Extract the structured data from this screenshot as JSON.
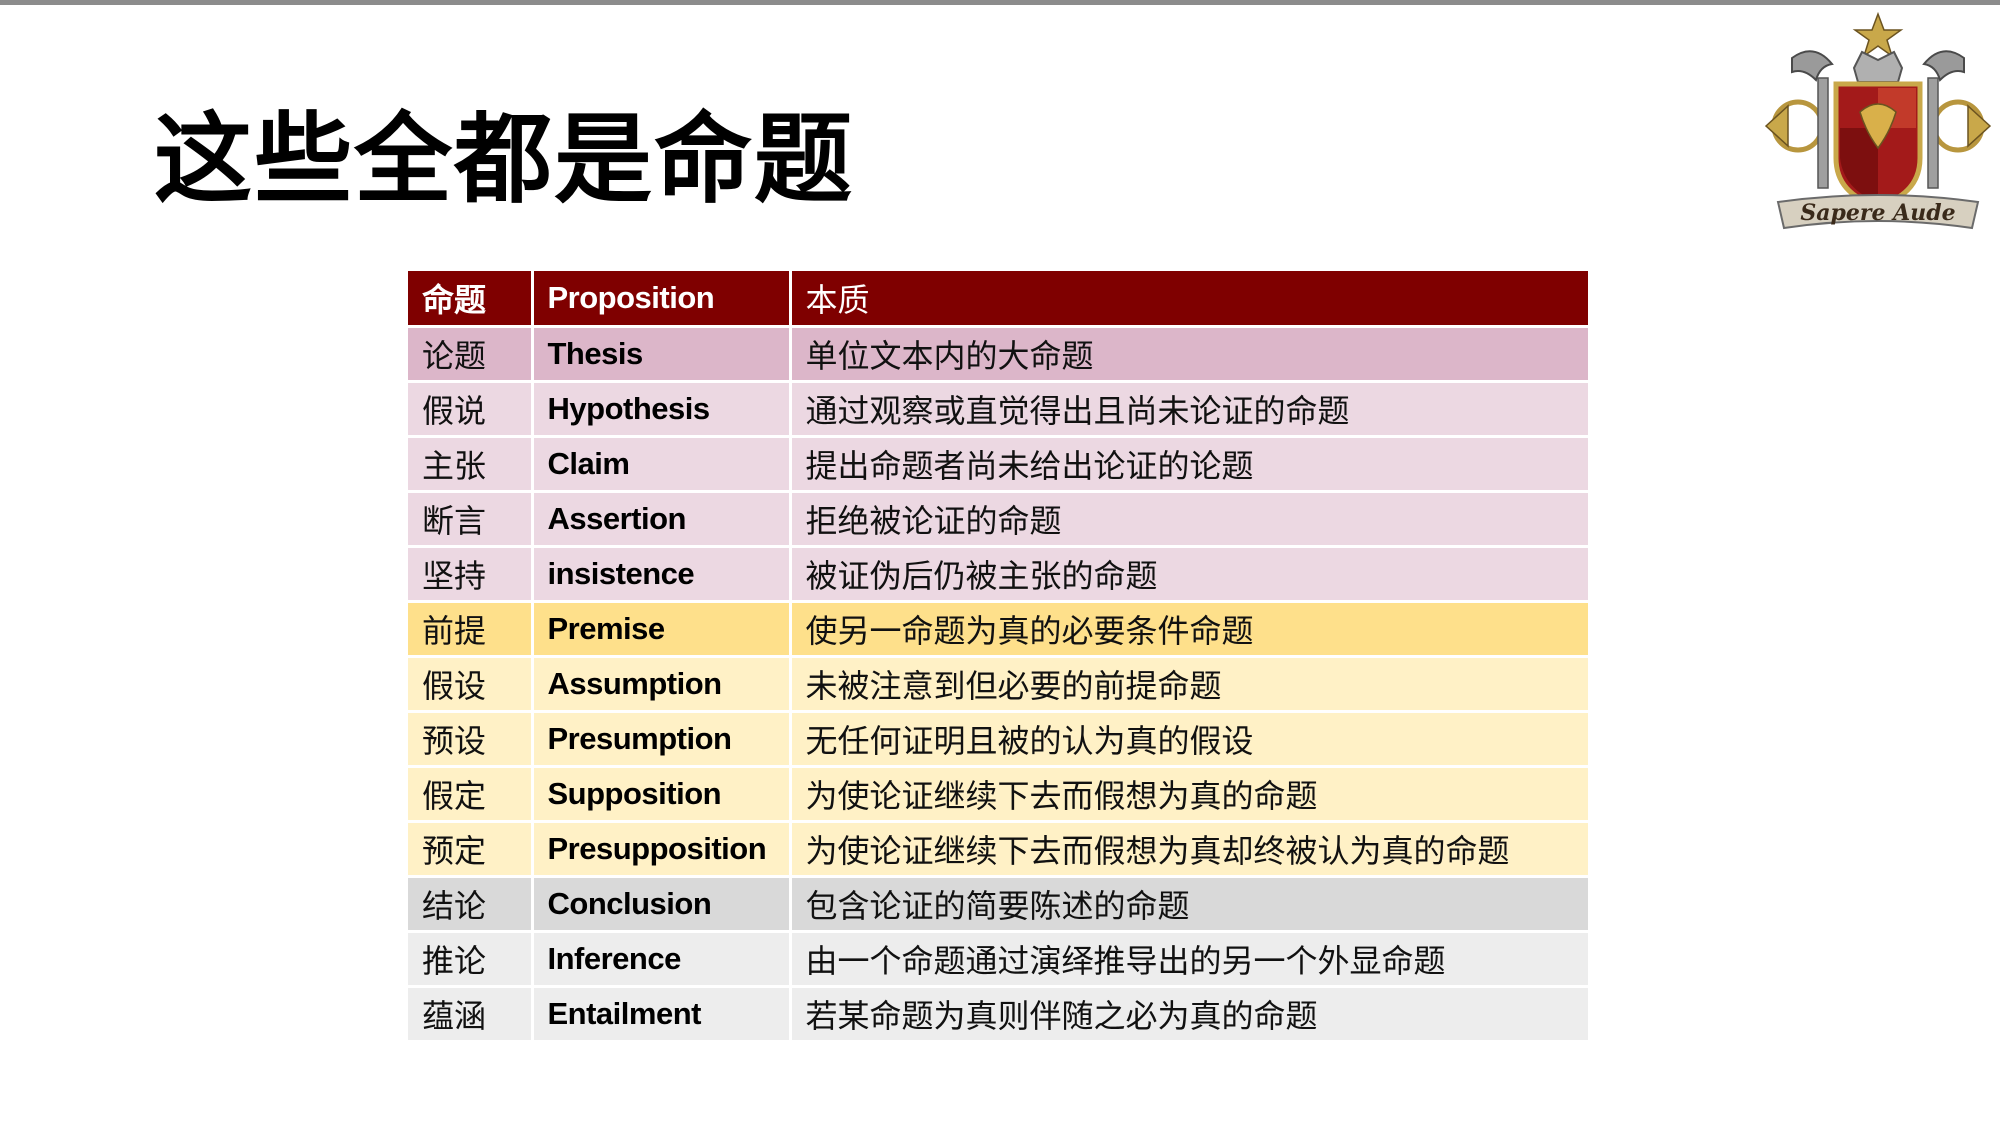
{
  "title": "这些全都是命题",
  "logo": {
    "icon": "heraldic-crest-icon",
    "motto": "Sapere Aude"
  },
  "colors": {
    "header": "#7f0000",
    "group_pink_dark": "#dcb6c9",
    "group_pink": "#ecd8e2",
    "group_yellow_dark": "#fee08b",
    "group_yellow": "#fff1c6",
    "group_gray_dark": "#d9d9d9",
    "group_gray": "#ededed"
  },
  "table": {
    "headers": [
      "命题",
      "Proposition",
      "本质"
    ],
    "rows": [
      {
        "zh": "论题",
        "en": "Thesis",
        "desc": "单位文本内的大命题"
      },
      {
        "zh": "假说",
        "en": "Hypothesis",
        "desc": "通过观察或直觉得出且尚未论证的命题"
      },
      {
        "zh": "主张",
        "en": "Claim",
        "desc": "提出命题者尚未给出论证的论题"
      },
      {
        "zh": "断言",
        "en": "Assertion",
        "desc": "拒绝被论证的命题"
      },
      {
        "zh": "坚持",
        "en": "insistence",
        "desc": "被证伪后仍被主张的命题"
      },
      {
        "zh": "前提",
        "en": "Premise",
        "desc": "使另一命题为真的必要条件命题"
      },
      {
        "zh": "假设",
        "en": "Assumption",
        "desc": "未被注意到但必要的前提命题"
      },
      {
        "zh": "预设",
        "en": "Presumption",
        "desc": "无任何证明且被的认为真的假设"
      },
      {
        "zh": "假定",
        "en": "Supposition",
        "desc": "为使论证继续下去而假想为真的命题"
      },
      {
        "zh": "预定",
        "en": "Presupposition",
        "desc": "为使论证继续下去而假想为真却终被认为真的命题"
      },
      {
        "zh": "结论",
        "en": "Conclusion",
        "desc": "包含论证的简要陈述的命题"
      },
      {
        "zh": "推论",
        "en": "Inference",
        "desc": "由一个命题通过演绎推导出的另一个外显命题"
      },
      {
        "zh": "蕴涵",
        "en": "Entailment",
        "desc": "若某命题为真则伴随之必为真的命题"
      }
    ]
  }
}
